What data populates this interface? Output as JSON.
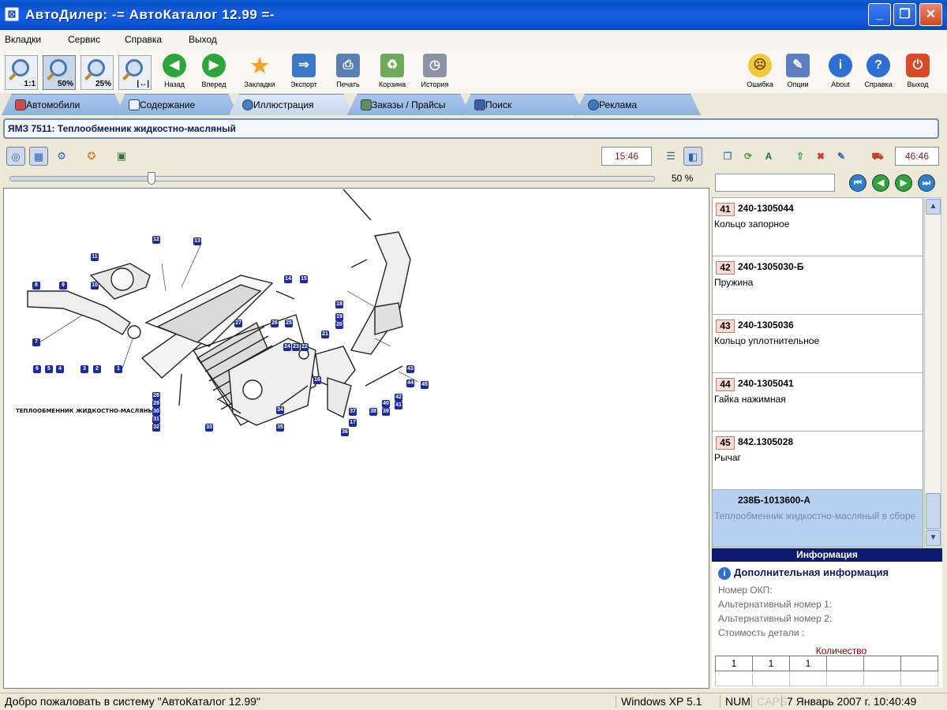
{
  "window": {
    "title": "АвтоДилер: -= АвтоКаталог 12.99 =-"
  },
  "menu": [
    "Вкладки",
    "Сервис",
    "Справка",
    "Выход"
  ],
  "toolbar": {
    "zoom": [
      "1:1",
      "50%",
      "25%",
      "|↔|"
    ],
    "back": "Назад",
    "forward": "Вперед",
    "bookmarks": "Закладки",
    "export": "Экспорт",
    "print": "Печать",
    "cart": "Корзина",
    "history": "История",
    "error": "Ошибка",
    "options": "Опции",
    "about": "About",
    "help": "Справка",
    "exit": "Выход"
  },
  "tabs": [
    "Автомобили",
    "Содержание",
    "Иллюстрация",
    "Заказы / Прайсы",
    "Поиск",
    "Реклама"
  ],
  "active_tab": "Иллюстрация",
  "heading": "ЯМЗ 7511: Теплообменник жидкостно-масляный",
  "image_panel": {
    "time_left": "15:46",
    "zoom_percent": "50 %",
    "zoom_fraction": 0.22,
    "drawing_caption": "ТЕПЛООБМЕННИК ЖИДКОСТНО-МАСЛЯНЫЙ",
    "callouts": [
      "1",
      "2",
      "3",
      "4",
      "5",
      "6",
      "7",
      "8",
      "9",
      "10",
      "11",
      "12",
      "13",
      "14",
      "15",
      "16",
      "17",
      "18",
      "19",
      "20",
      "21",
      "22",
      "23",
      "24",
      "25",
      "26",
      "27",
      "28",
      "29",
      "30",
      "31",
      "32",
      "33",
      "34",
      "35",
      "36",
      "37",
      "38",
      "39",
      "40",
      "41",
      "42",
      "43",
      "44",
      "45"
    ]
  },
  "right_panel": {
    "time_right": "46:46",
    "search_value": "",
    "parts": [
      {
        "num": "41",
        "code": "240-1305044",
        "name": "Кольцо запорное"
      },
      {
        "num": "42",
        "code": "240-1305030-Б",
        "name": "Пружина"
      },
      {
        "num": "43",
        "code": "240-1305036",
        "name": "Кольцо уплотнительное"
      },
      {
        "num": "44",
        "code": "240-1305041",
        "name": "Гайка нажимная"
      },
      {
        "num": "45",
        "code": "842.1305028",
        "name": "Рычаг"
      },
      {
        "num": "",
        "code": "238Б-1013600-А",
        "name": "Теплообменник жидкостно-масляный в сборе"
      }
    ],
    "selected_index": 5,
    "info": {
      "header": "Информация",
      "title": "Дополнительная информация",
      "fields": [
        "Номер ОКП:",
        "Альтернативный номер 1:",
        "Альтернативный номер 2:",
        "Стоимость детали :"
      ],
      "qty_label": "Количество",
      "qty_values": [
        "1",
        "1",
        "1"
      ]
    }
  },
  "status": {
    "message": "Добро пожаловать в систему \"АвтоКаталог 12.99\"",
    "os": "Windows XP 5.1",
    "num": "NUM",
    "caps": "CAPS",
    "datetime": "7 Январь 2007 г. 10:40:49"
  }
}
